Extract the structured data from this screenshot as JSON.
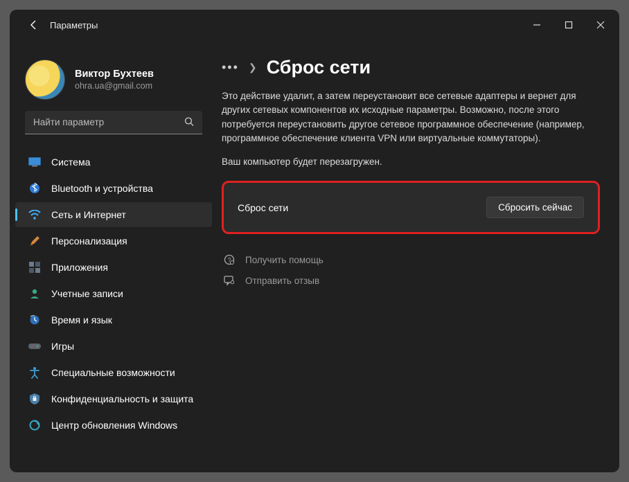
{
  "window_title": "Параметры",
  "user": {
    "name": "Виктор Бухтеев",
    "email": "ohra.ua@gmail.com"
  },
  "search": {
    "placeholder": "Найти параметр"
  },
  "nav": [
    {
      "label": "Система",
      "icon": "system"
    },
    {
      "label": "Bluetooth и устройства",
      "icon": "bluetooth"
    },
    {
      "label": "Сеть и Интернет",
      "icon": "wifi"
    },
    {
      "label": "Персонализация",
      "icon": "brush"
    },
    {
      "label": "Приложения",
      "icon": "apps"
    },
    {
      "label": "Учетные записи",
      "icon": "account"
    },
    {
      "label": "Время и язык",
      "icon": "time"
    },
    {
      "label": "Игры",
      "icon": "games"
    },
    {
      "label": "Специальные возможности",
      "icon": "access"
    },
    {
      "label": "Конфиденциальность и защита",
      "icon": "privacy"
    },
    {
      "label": "Центр обновления Windows",
      "icon": "update"
    }
  ],
  "nav_active_index": 2,
  "breadcrumb": {
    "title": "Сброс сети"
  },
  "description": "Это действие удалит, а затем переустановит все сетевые адаптеры и вернет для других сетевых компонентов их исходные параметры. Возможно, после этого потребуется переустановить другое сетевое программное обеспечение (например, программное обеспечение клиента VPN или виртуальные коммутаторы).",
  "warning": "Ваш компьютер будет перезагружен.",
  "card": {
    "label": "Сброс сети",
    "button": "Сбросить сейчас"
  },
  "help": {
    "get": "Получить помощь",
    "feedback": "Отправить отзыв"
  }
}
